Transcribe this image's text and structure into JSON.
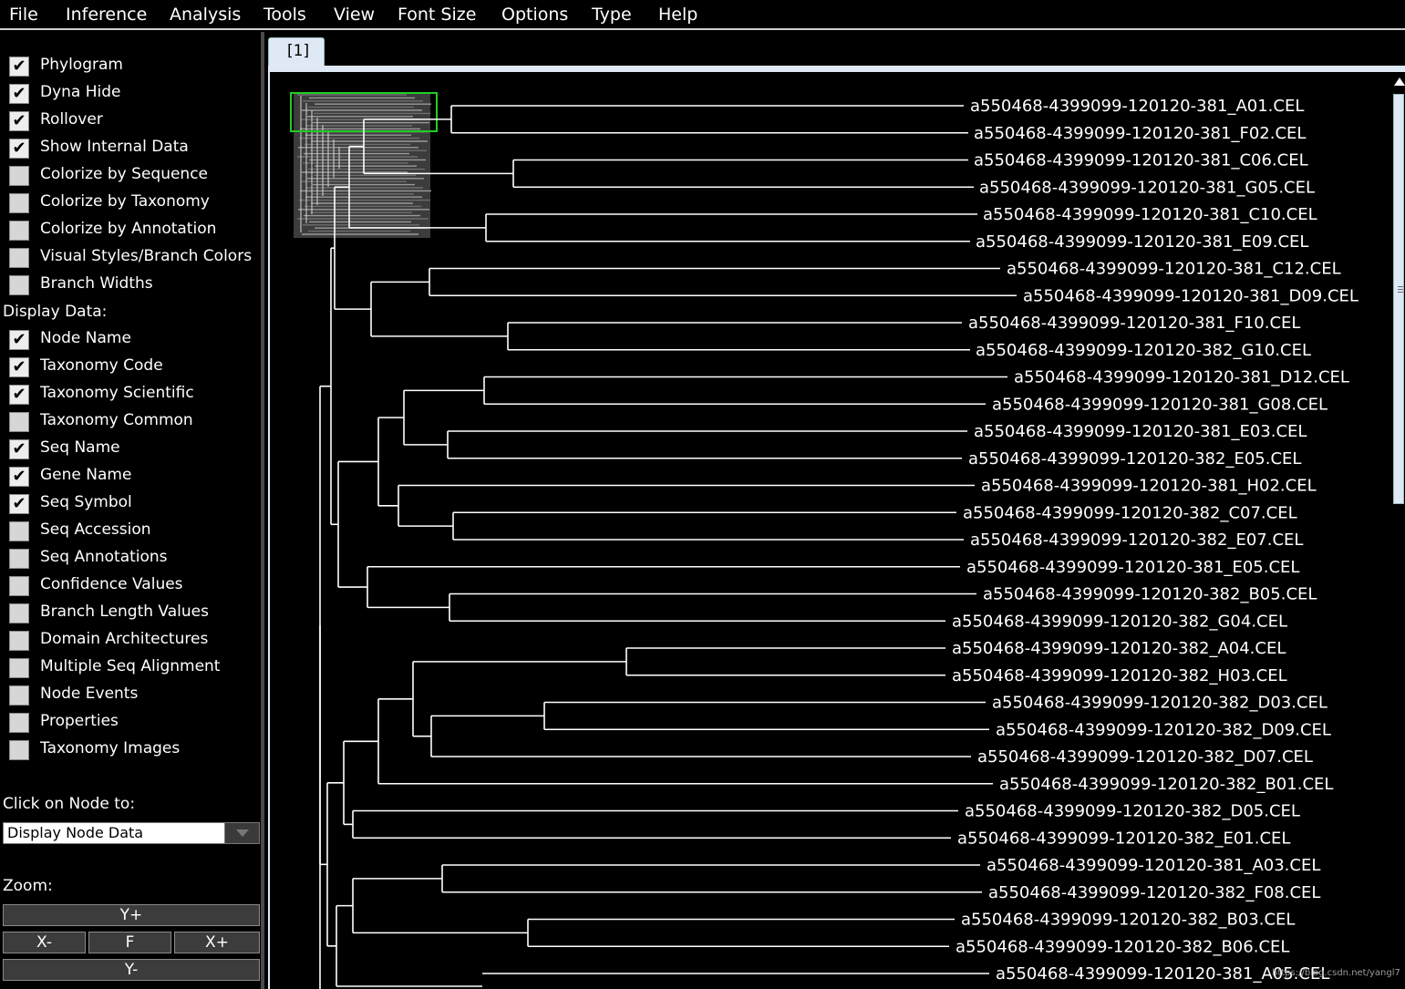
{
  "menubar": {
    "items": [
      "File",
      "Inference",
      "Analysis",
      "Tools",
      "View",
      "Font Size",
      "Options",
      "Type",
      "Help"
    ]
  },
  "sidebar": {
    "options": [
      {
        "label": "Phylogram",
        "checked": true
      },
      {
        "label": "Dyna Hide",
        "checked": true
      },
      {
        "label": "Rollover",
        "checked": true
      },
      {
        "label": "Show Internal Data",
        "checked": true
      },
      {
        "label": "Colorize by Sequence",
        "checked": false
      },
      {
        "label": "Colorize by Taxonomy",
        "checked": false
      },
      {
        "label": "Colorize by Annotation",
        "checked": false
      },
      {
        "label": "Visual Styles/Branch Colors",
        "checked": false
      },
      {
        "label": "Branch Widths",
        "checked": false
      }
    ],
    "display_data_label": "Display Data:",
    "display_options": [
      {
        "label": "Node Name",
        "checked": true
      },
      {
        "label": "Taxonomy Code",
        "checked": true
      },
      {
        "label": "Taxonomy Scientific",
        "checked": true
      },
      {
        "label": "Taxonomy Common",
        "checked": false
      },
      {
        "label": "Seq Name",
        "checked": true
      },
      {
        "label": "Gene Name",
        "checked": true
      },
      {
        "label": "Seq Symbol",
        "checked": true
      },
      {
        "label": "Seq Accession",
        "checked": false
      },
      {
        "label": "Seq Annotations",
        "checked": false
      },
      {
        "label": "Confidence Values",
        "checked": false
      },
      {
        "label": "Branch Length Values",
        "checked": false
      },
      {
        "label": "Domain Architectures",
        "checked": false
      },
      {
        "label": "Multiple Seq Alignment",
        "checked": false
      },
      {
        "label": "Node Events",
        "checked": false
      },
      {
        "label": "Properties",
        "checked": false
      },
      {
        "label": "Taxonomy Images",
        "checked": false
      }
    ],
    "click_on_node_label": "Click on Node to:",
    "click_on_node_value": "Display Node Data",
    "zoom_label": "Zoom:",
    "zoom": {
      "y_plus": "Y+",
      "x_minus": "X-",
      "fit": "F",
      "x_plus": "X+",
      "y_minus": "Y-"
    }
  },
  "tabs": [
    {
      "label": "[1]",
      "active": true
    }
  ],
  "tree": {
    "leaves": [
      "a550468-4399099-120120-381_A01.CEL",
      "a550468-4399099-120120-381_F02.CEL",
      "a550468-4399099-120120-381_C06.CEL",
      "a550468-4399099-120120-381_G05.CEL",
      "a550468-4399099-120120-381_C10.CEL",
      "a550468-4399099-120120-381_E09.CEL",
      "a550468-4399099-120120-381_C12.CEL",
      "a550468-4399099-120120-381_D09.CEL",
      "a550468-4399099-120120-381_F10.CEL",
      "a550468-4399099-120120-382_G10.CEL",
      "a550468-4399099-120120-381_D12.CEL",
      "a550468-4399099-120120-381_G08.CEL",
      "a550468-4399099-120120-381_E03.CEL",
      "a550468-4399099-120120-382_E05.CEL",
      "a550468-4399099-120120-381_H02.CEL",
      "a550468-4399099-120120-382_C07.CEL",
      "a550468-4399099-120120-382_E07.CEL",
      "a550468-4399099-120120-381_E05.CEL",
      "a550468-4399099-120120-382_B05.CEL",
      "a550468-4399099-120120-382_G04.CEL",
      "a550468-4399099-120120-382_A04.CEL",
      "a550468-4399099-120120-382_H03.CEL",
      "a550468-4399099-120120-382_D03.CEL",
      "a550468-4399099-120120-382_D09.CEL",
      "a550468-4399099-120120-382_D07.CEL",
      "a550468-4399099-120120-382_B01.CEL",
      "a550468-4399099-120120-382_D05.CEL",
      "a550468-4399099-120120-382_E01.CEL",
      "a550468-4399099-120120-381_A03.CEL",
      "a550468-4399099-120120-382_F08.CEL",
      "a550468-4399099-120120-382_B03.CEL",
      "a550468-4399099-120120-382_B06.CEL",
      "a550468-4399099-120120-381_A05.CEL"
    ]
  },
  "watermark": "https://blog.csdn.net/yangl7",
  "colors": {
    "background": "#000000",
    "branch": "#ffffff",
    "overview_box": "#22cc22",
    "panel_accent": "#dfe9f5"
  }
}
